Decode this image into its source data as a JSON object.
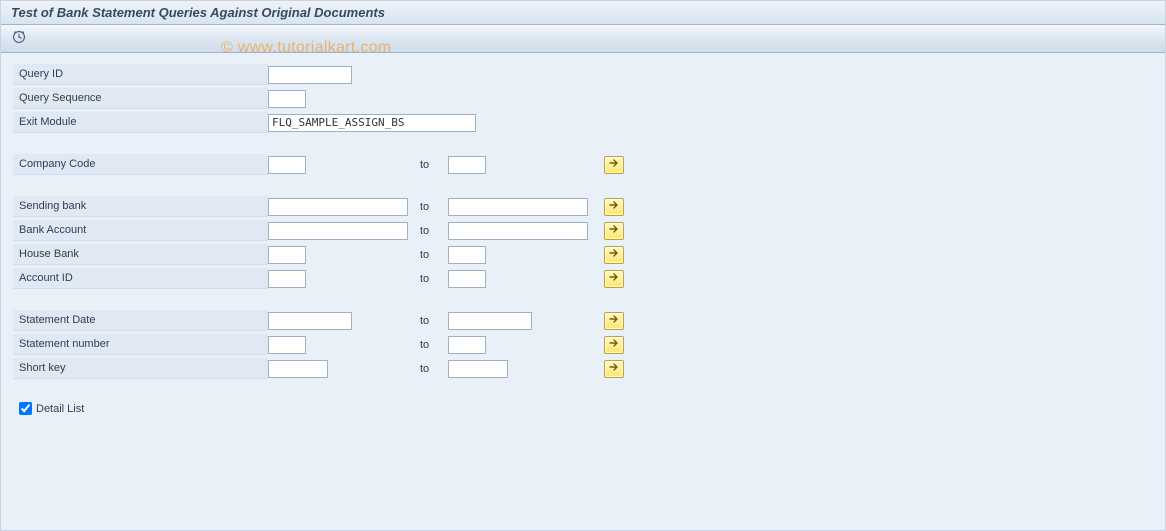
{
  "header": {
    "title": "Test of Bank Statement Queries Against Original Documents"
  },
  "watermark": "© www.tutorialkart.com",
  "fields": {
    "query_id": {
      "label": "Query ID",
      "value": ""
    },
    "query_sequence": {
      "label": "Query Sequence",
      "value": ""
    },
    "exit_module": {
      "label": "Exit Module",
      "value": "FLQ_SAMPLE_ASSIGN_BS"
    },
    "company_code": {
      "label": "Company Code",
      "from": "",
      "to_label": "to",
      "to": ""
    },
    "sending_bank": {
      "label": "Sending bank",
      "from": "",
      "to_label": "to",
      "to": ""
    },
    "bank_account": {
      "label": "Bank Account",
      "from": "",
      "to_label": "to",
      "to": ""
    },
    "house_bank": {
      "label": "House Bank",
      "from": "",
      "to_label": "to",
      "to": ""
    },
    "account_id": {
      "label": "Account ID",
      "from": "",
      "to_label": "to",
      "to": ""
    },
    "statement_date": {
      "label": "Statement Date",
      "from": "",
      "to_label": "to",
      "to": ""
    },
    "statement_number": {
      "label": "Statement number",
      "from": "",
      "to_label": "to",
      "to": ""
    },
    "short_key": {
      "label": "Short key",
      "from": "",
      "to_label": "to",
      "to": ""
    }
  },
  "checkbox": {
    "detail_list": {
      "label": "Detail List",
      "checked": true
    }
  },
  "icons": {
    "execute": "clock-execute-icon",
    "multi": "multiple-selection-arrow-icon"
  },
  "colors": {
    "panel_bg": "#e9f0f8",
    "label_bg": "#e0e9f3",
    "button_yellow": "#ffe76e"
  }
}
